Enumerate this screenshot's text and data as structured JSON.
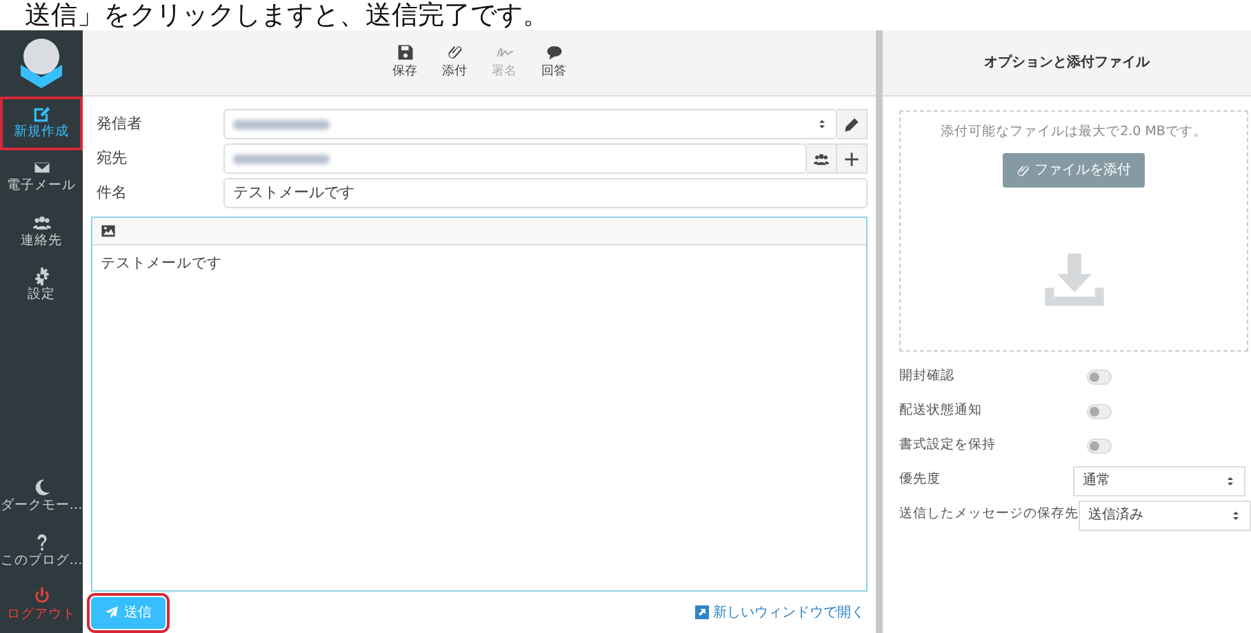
{
  "caption": "送信」をクリックしますと、送信完了です。",
  "sidebar": {
    "items": [
      {
        "label": "新規作成",
        "selected": true,
        "highlighted": true
      },
      {
        "label": "電子メール",
        "selected": false,
        "highlighted": false
      },
      {
        "label": "連絡先",
        "selected": false,
        "highlighted": false
      },
      {
        "label": "設定",
        "selected": false,
        "highlighted": false
      }
    ],
    "bottom_items": [
      {
        "label": "ダークモー…",
        "kind": "normal"
      },
      {
        "label": "このブログ…",
        "kind": "normal"
      },
      {
        "label": "ログアウト",
        "kind": "danger"
      }
    ]
  },
  "toolbar": [
    {
      "label": "保存",
      "disabled": false
    },
    {
      "label": "添付",
      "disabled": false
    },
    {
      "label": "署名",
      "disabled": true
    },
    {
      "label": "回答",
      "disabled": false
    }
  ],
  "header_fields": [
    {
      "label": "発信者",
      "kind": "select"
    },
    {
      "label": "宛先",
      "kind": "recipients"
    },
    {
      "label": "件名",
      "kind": "text",
      "value": "テストメールです"
    }
  ],
  "editor": {
    "body": "テストメールです"
  },
  "send_button": {
    "label": "送信",
    "highlighted": true
  },
  "open_window_link": "新しいウィンドウで開く",
  "options_panel": {
    "title": "オプションと添付ファイル",
    "attach_note": "添付可能なファイルは最大で2.0 MBです。",
    "attach_button": "ファイルを添付",
    "options": [
      {
        "label": "開封確認",
        "kind": "toggle",
        "on": false
      },
      {
        "label": "配送状態通知",
        "kind": "toggle",
        "on": false
      },
      {
        "label": "書式設定を保持",
        "kind": "toggle",
        "on": false
      },
      {
        "label": "優先度",
        "kind": "select",
        "value": "通常"
      },
      {
        "label": "送信したメッセージの保存先",
        "kind": "select",
        "value": "送信済み"
      }
    ]
  }
}
